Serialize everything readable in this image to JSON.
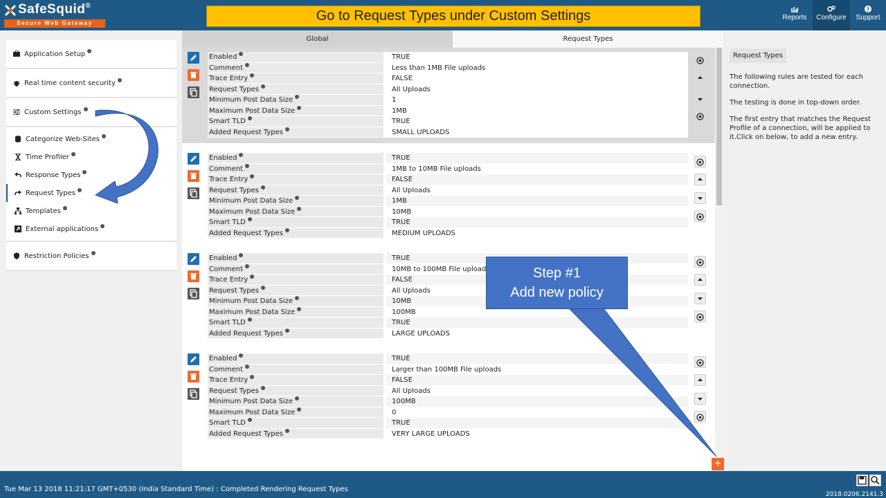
{
  "brand": {
    "name": "SafeSquid",
    "reg": "®",
    "tagline": "Secure Web Gateway"
  },
  "banner": "Go to Request Types under Custom Settings",
  "topnav": [
    {
      "label": "Reports",
      "icon": "chart-icon"
    },
    {
      "label": "Configure",
      "icon": "gears-icon",
      "active": true
    },
    {
      "label": "Support",
      "icon": "question-icon"
    }
  ],
  "sidebar": {
    "groups": [
      {
        "label": "Application Setup",
        "icon": "briefcase-icon"
      },
      {
        "label": "Real time content security",
        "icon": "bug-icon"
      },
      {
        "label": "Custom Settings",
        "icon": "sliders-icon"
      }
    ],
    "sub": [
      {
        "label": "Categorize Web-Sites",
        "icon": "database-icon"
      },
      {
        "label": "Time Profiler",
        "icon": "hourglass-icon"
      },
      {
        "label": "Response Types",
        "icon": "reply-icon"
      },
      {
        "label": "Request Types",
        "icon": "share-icon",
        "active": true
      },
      {
        "label": "Templates",
        "icon": "sitemap-icon"
      },
      {
        "label": "External applications",
        "icon": "external-icon"
      }
    ],
    "last": {
      "label": "Restriction Policies",
      "icon": "shield-icon"
    }
  },
  "tabs": {
    "global": "Global",
    "request_types": "Request Types"
  },
  "field_labels": {
    "enabled": "Enabled",
    "comment": "Comment",
    "trace": "Trace Entry",
    "request_types": "Request Types",
    "min_post": "Minimum Post Data Size",
    "max_post": "Maximum Post Data Size",
    "smart_tld": "Smart TLD",
    "added": "Added Request Types"
  },
  "policies": [
    {
      "enabled": "TRUE",
      "comment": "Less than 1MB File uploads",
      "trace": "FALSE",
      "request_types": "All Uploads",
      "min_post": "1",
      "max_post": "1MB",
      "smart_tld": "TRUE",
      "added": "SMALL UPLOADS"
    },
    {
      "enabled": "TRUE",
      "comment": "1MB to 10MB File uploads",
      "trace": "FALSE",
      "request_types": "All Uploads",
      "min_post": "1MB",
      "max_post": "10MB",
      "smart_tld": "TRUE",
      "added": "MEDIUM UPLOADS"
    },
    {
      "enabled": "TRUE",
      "comment": "10MB to 100MB File uploads",
      "trace": "FALSE",
      "request_types": "All Uploads",
      "min_post": "10MB",
      "max_post": "100MB",
      "smart_tld": "TRUE",
      "added": "LARGE UPLOADS"
    },
    {
      "enabled": "TRUE",
      "comment": "Larger than 100MB File uploads",
      "trace": "FALSE",
      "request_types": "All Uploads",
      "min_post": "100MB",
      "max_post": "0",
      "smart_tld": "TRUE",
      "added": "VERY LARGE UPLOADS"
    }
  ],
  "help": {
    "title": "Request Types",
    "p1": "The following rules are tested for each connection.",
    "p2": "The testing is done in top-down order.",
    "p3": "The first entry that matches the Request Profile of a connection, will be applied to it.Click on below, to add a new entry."
  },
  "callout": {
    "line1": "Step #1",
    "line2": "Add new policy"
  },
  "add_button": "+",
  "footer": {
    "status": "Tue Mar 13 2018 11:21:17 GMT+0530 (India Standard Time) : Completed Rendering Request Types",
    "version": "2018.0206.2141.3"
  },
  "colors": {
    "header": "#1f5a87",
    "banner": "#ffc000",
    "accent": "#ee6a2c",
    "edit": "#1e6fb0",
    "callout": "#4472c4"
  }
}
